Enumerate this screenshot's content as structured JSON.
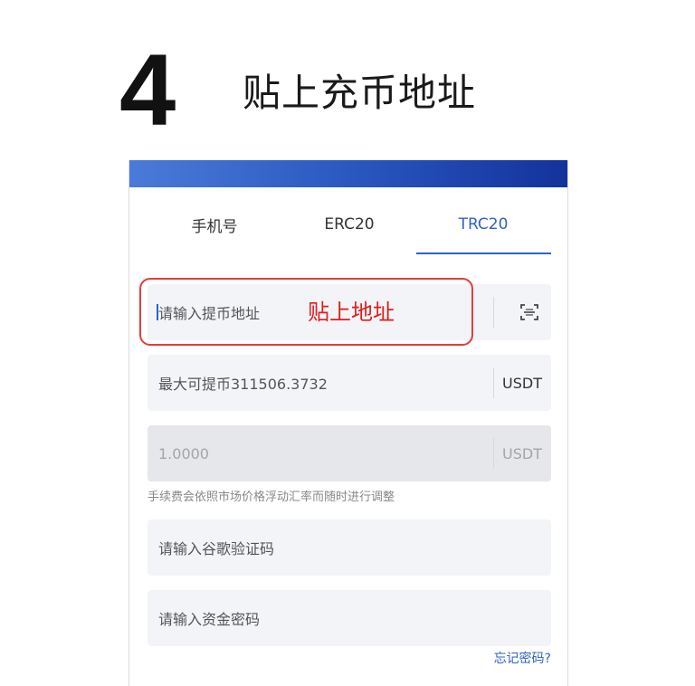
{
  "step": {
    "number": "4",
    "title": "贴上充币地址"
  },
  "tabs": [
    {
      "label": "手机号"
    },
    {
      "label": "ERC20"
    },
    {
      "label": "TRC20"
    }
  ],
  "active_tab": "TRC20",
  "address_field": {
    "placeholder": "请输入提币地址"
  },
  "annotation": {
    "label": "贴上地址",
    "color": "#e31b1b"
  },
  "max_field": {
    "text": "最大可提币311506.3732",
    "unit": "USDT"
  },
  "fee_field": {
    "value": "1.0000",
    "unit": "USDT"
  },
  "fee_note": "手续费会依照市场价格浮动汇率而随时进行调整",
  "google_code_field": {
    "placeholder": "请输入谷歌验证码"
  },
  "fund_password_field": {
    "placeholder": "请输入资金密码"
  },
  "forgot_password": "忘记密码?",
  "colors": {
    "accent": "#2f62c7",
    "highlight": "#e53b3b",
    "header_gradient_end": "#13329c"
  },
  "icons": {
    "scan": "scan-icon"
  }
}
